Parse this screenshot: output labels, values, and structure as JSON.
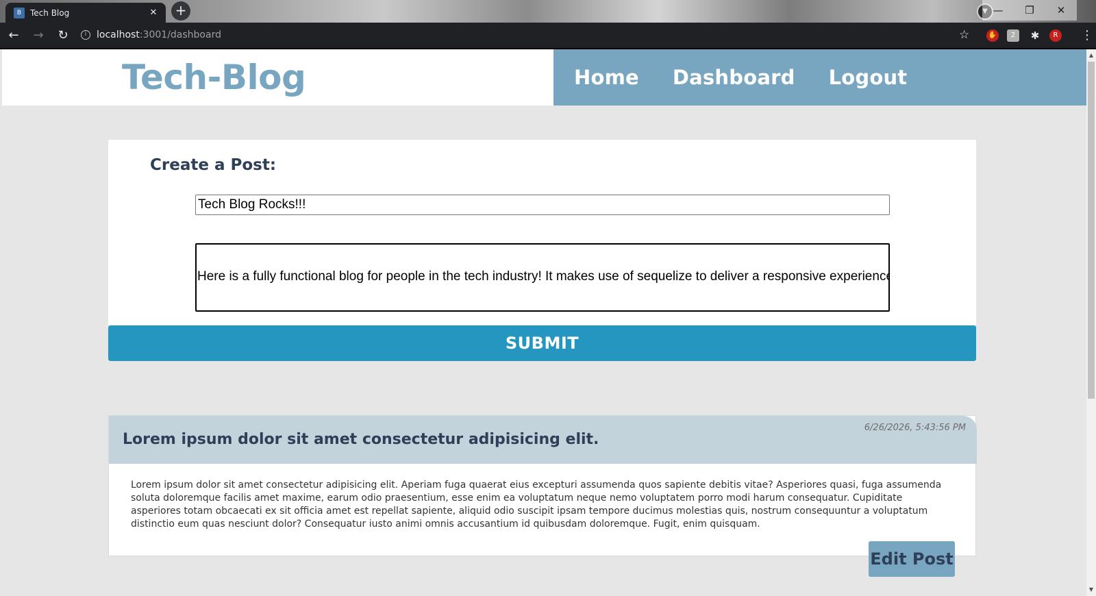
{
  "browser": {
    "tab_title": "Tech Blog",
    "tab_favicon": "B",
    "url_host": "localhost",
    "url_path": ":3001/dashboard",
    "profile_initial": "R",
    "extension_badge": "2"
  },
  "site": {
    "title": "Tech-Blog",
    "nav": [
      "Home",
      "Dashboard",
      "Logout"
    ],
    "colors": {
      "accent": "#78a6c0",
      "submit": "#2596c0",
      "heading": "#2e3f57",
      "background": "#e6e6e6"
    }
  },
  "create_post": {
    "heading": "Create a Post:",
    "title_value": "Tech Blog Rocks!!!",
    "body_value": "Here is a fully functional blog for people in the tech industry! It makes use of sequelize to deliver a responsive experience",
    "submit_label": "SUBMIT"
  },
  "posts": [
    {
      "title": "Lorem ipsum dolor sit amet consectetur adipisicing elit.",
      "date": "6/26/2026, 5:43:56 PM",
      "body": "Lorem ipsum dolor sit amet consectetur adipisicing elit. Aperiam fuga quaerat eius excepturi assumenda quos sapiente debitis vitae? Asperiores quasi, fuga assumenda soluta doloremque facilis amet maxime, earum odio praesentium, esse enim ea voluptatum neque nemo voluptatem porro modi harum consequatur. Cupiditate asperiores totam obcaecati ex sit officia amet est repellat sapiente, aliquid odio suscipit ipsam tempore ducimus molestias quis, nostrum consequuntur a voluptatum distinctio eum quas nesciunt dolor? Consequatur iusto animi omnis accusantium id quibusdam doloremque. Fugit, enim quisquam.",
      "edit_label": "Edit Post"
    }
  ]
}
